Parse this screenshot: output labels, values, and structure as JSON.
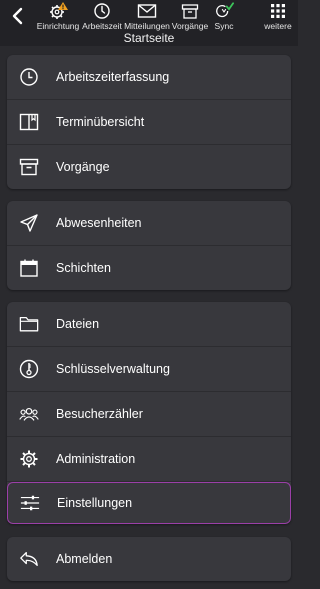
{
  "toolbar": {
    "buttons": [
      {
        "label": "Einrichtung",
        "icon": "gear-warning-icon"
      },
      {
        "label": "Arbeitszeit",
        "icon": "clock-icon"
      },
      {
        "label": "Mitteilungen",
        "icon": "mail-icon"
      },
      {
        "label": "Vorgänge",
        "icon": "archive-box-icon"
      },
      {
        "label": "Sync",
        "icon": "sync-check-icon"
      },
      {
        "label": "weitere",
        "icon": "grid-dots-icon"
      }
    ],
    "back_icon": "back-chevron-icon"
  },
  "page": {
    "title": "Startseite"
  },
  "menu": {
    "group1": [
      {
        "label": "Arbeitszeiterfassung",
        "icon": "clock-icon"
      },
      {
        "label": "Terminübersicht",
        "icon": "book-icon"
      },
      {
        "label": "Vorgänge",
        "icon": "archive-box-icon"
      }
    ],
    "group2": [
      {
        "label": "Abwesenheiten",
        "icon": "paper-plane-icon"
      },
      {
        "label": "Schichten",
        "icon": "calendar-icon"
      }
    ],
    "group3": [
      {
        "label": "Dateien",
        "icon": "folder-icon"
      },
      {
        "label": "Schlüsselverwaltung",
        "icon": "key-icon"
      },
      {
        "label": "Besucherzähler",
        "icon": "people-icon"
      },
      {
        "label": "Administration",
        "icon": "gear-icon"
      },
      {
        "label": "Einstellungen",
        "icon": "sliders-icon"
      }
    ],
    "group4": [
      {
        "label": "Abmelden",
        "icon": "reply-icon"
      }
    ]
  },
  "colors": {
    "background": "#2a2a2e",
    "card": "#38383d",
    "highlight_border": "#9b3fa8",
    "warning": "#f0a020",
    "sync_check": "#3cc45a"
  }
}
